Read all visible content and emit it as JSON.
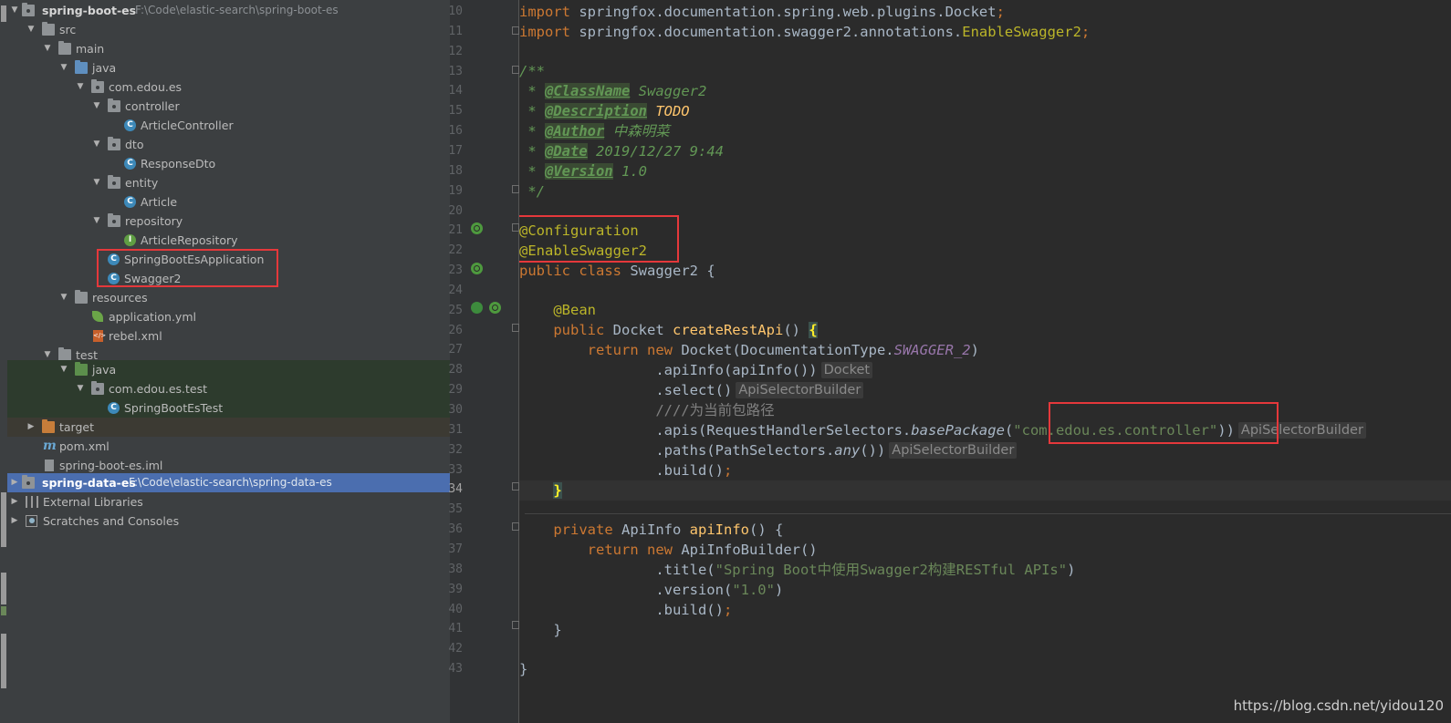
{
  "project_tree": {
    "rows": [
      {
        "label": "spring-boot-es",
        "path": "F:\\Code\\elastic-search\\spring-boot-es",
        "expanded": true,
        "icon": "module-folder-icon"
      },
      {
        "label": "src",
        "expanded": true,
        "icon": "folder-icon"
      },
      {
        "label": "main",
        "expanded": true,
        "icon": "folder-icon"
      },
      {
        "label": "java",
        "expanded": true,
        "icon": "source-folder-icon"
      },
      {
        "label": "com.edou.es",
        "expanded": true,
        "icon": "package-icon"
      },
      {
        "label": "controller",
        "expanded": true,
        "icon": "package-icon"
      },
      {
        "label": "ArticleController",
        "icon": "class-icon"
      },
      {
        "label": "dto",
        "expanded": true,
        "icon": "package-icon"
      },
      {
        "label": "ResponseDto",
        "icon": "class-icon"
      },
      {
        "label": "entity",
        "expanded": true,
        "icon": "package-icon"
      },
      {
        "label": "Article",
        "icon": "class-icon"
      },
      {
        "label": "repository",
        "expanded": true,
        "icon": "package-icon"
      },
      {
        "label": "ArticleRepository",
        "icon": "interface-icon"
      },
      {
        "label": "SpringBootEsApplication",
        "icon": "spring-boot-class-icon"
      },
      {
        "label": "Swagger2",
        "icon": "class-icon"
      },
      {
        "label": "resources",
        "expanded": true,
        "icon": "resources-folder-icon"
      },
      {
        "label": "application.yml",
        "icon": "spring-config-icon"
      },
      {
        "label": "rebel.xml",
        "icon": "xml-icon"
      },
      {
        "label": "test",
        "expanded": true,
        "icon": "folder-icon"
      },
      {
        "label": "java",
        "expanded": true,
        "icon": "test-folder-icon"
      },
      {
        "label": "com.edou.es.test",
        "expanded": true,
        "icon": "package-icon"
      },
      {
        "label": "SpringBootEsTest",
        "icon": "spring-test-class-icon"
      },
      {
        "label": "target",
        "expanded": false,
        "icon": "excluded-folder-icon"
      },
      {
        "label": "pom.xml",
        "icon": "maven-icon"
      },
      {
        "label": "spring-boot-es.iml",
        "icon": "iml-file-icon"
      },
      {
        "label": "spring-data-es",
        "path": "F:\\Code\\elastic-search\\spring-data-es",
        "expanded": false,
        "icon": "module-folder-icon"
      },
      {
        "label": "External Libraries",
        "expanded": false,
        "icon": "libraries-icon"
      },
      {
        "label": "Scratches and Consoles",
        "expanded": false,
        "icon": "scratches-icon"
      }
    ]
  },
  "editor": {
    "line_numbers": [
      "10",
      "11",
      "12",
      "13",
      "14",
      "15",
      "16",
      "17",
      "18",
      "19",
      "20",
      "21",
      "22",
      "23",
      "24",
      "25",
      "26",
      "27",
      "28",
      "29",
      "30",
      "31",
      "32",
      "33",
      "34",
      "35",
      "36",
      "37",
      "38",
      "39",
      "40",
      "41",
      "42",
      "43"
    ],
    "current_line": "34",
    "code": {
      "l10_import": "import",
      "l10_rest": " springfox.documentation.spring.web.plugins.Docket",
      "l11_import": "import",
      "l11_pkg": " springfox.documentation.swagger2.annotations.",
      "l11_ann": "EnableSwagger2",
      "l13": "/**",
      "l14_prefix": " * ",
      "l14_tag": "@ClassName",
      "l14_val": " Swagger2",
      "l15_tag": "@Description",
      "l15_val": " TODO",
      "l16_tag": "@Author",
      "l16_val": " 中森明菜",
      "l17_tag": "@Date",
      "l17_val": " 2019/12/27 9:44",
      "l18_tag": "@Version",
      "l18_val": " 1.0",
      "l19": " */",
      "l21": "@Configuration",
      "l22": "@EnableSwagger2",
      "l23_public": "public",
      "l23_class": "class",
      "l23_name": " Swagger2 {",
      "l25": "@Bean",
      "l26_public": "public",
      "l26_type": " Docket ",
      "l26_method": "createRestApi",
      "l26_parens": "() ",
      "l26_brace": "{",
      "l27_return": "return",
      "l27_new": "new",
      "l27_mid": " Docket(DocumentationType.",
      "l27_static": "SWAGGER_2",
      "l27_end": ")",
      "l28": ".apiInfo(apiInfo())",
      "l28_hint": "Docket",
      "l29": ".select()",
      "l29_hint": "ApiSelectorBuilder",
      "l30": "////为当前包路径",
      "l31_a": ".apis(RequestHandlerSelectors.",
      "l31_method": "basePackage",
      "l31_b": "(",
      "l31_str": "\"com.edou.es.controller\"",
      "l31_c": "))",
      "l31_hint": "ApiSelectorBuilder",
      "l32_a": ".paths(PathSelectors.",
      "l32_method": "any",
      "l32_b": "())",
      "l32_hint": "ApiSelectorBuilder",
      "l33_a": ".build()",
      "l33_b": ";",
      "l34": "}",
      "l36_private": "private",
      "l36_type": " ApiInfo ",
      "l36_method": "apiInfo",
      "l36_rest": "() {",
      "l37_return": "return",
      "l37_new": "new",
      "l37_rest": " ApiInfoBuilder()",
      "l38_a": ".title(",
      "l38_str": "\"Spring Boot中使用Swagger2构建RESTful APIs\"",
      "l38_b": ")",
      "l39_a": ".version(",
      "l39_str": "\"1.0\"",
      "l39_b": ")",
      "l40_a": ".build()",
      "l40_b": ";",
      "l41": "}",
      "l43": "}"
    }
  },
  "watermark": "https://blog.csdn.net/yidou120",
  "colors": {
    "keyword": "#cc7832",
    "annotation": "#bbb529",
    "doc_comment": "#629755",
    "string": "#6a8759",
    "method": "#ffc66d",
    "highlight_box": "#e5383b",
    "selection": "#4b6eaf"
  }
}
